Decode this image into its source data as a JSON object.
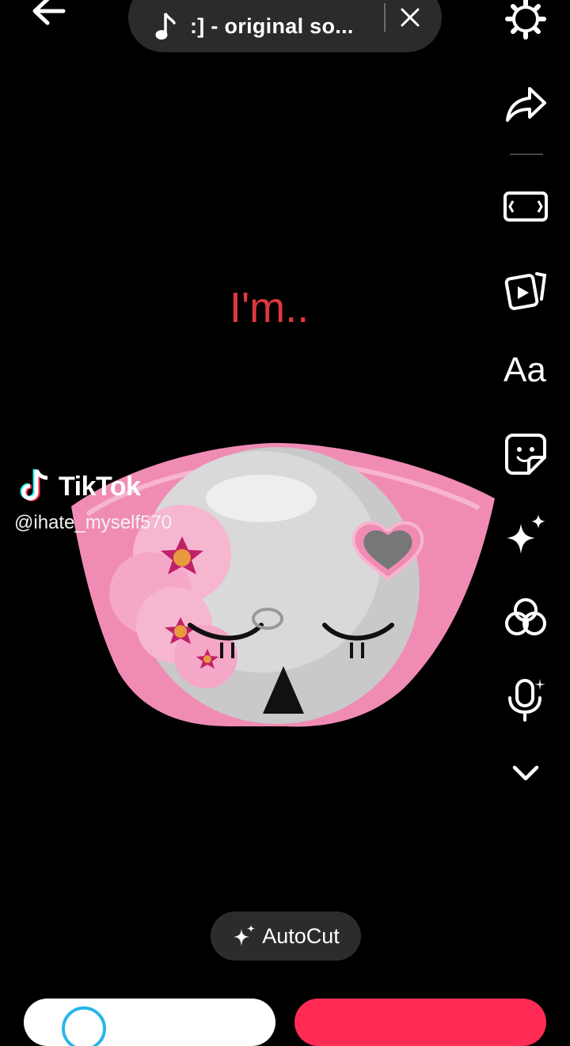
{
  "top_bar": {
    "back_icon": "arrow-left-icon",
    "sound_title": ":] - original so...",
    "note_icon": "music-note-icon",
    "close_icon": "close-icon"
  },
  "right_rail": {
    "icons": [
      "settings-gear-icon",
      "share-arrow-icon",
      "aspect-ratio-icon",
      "templates-icon",
      "text-icon",
      "sticker-icon",
      "effects-sparkle-icon",
      "filters-icon",
      "voice-effects-icon",
      "more-chevron-icon"
    ],
    "text_label": "Aa"
  },
  "video": {
    "caption": "I'm..",
    "watermark_brand": "TikTok",
    "watermark_user": "@ihate_myself570"
  },
  "bottom": {
    "autocut_label": "AutoCut"
  },
  "colors": {
    "caption": "#e0373f",
    "post_button": "#ff2b55",
    "pill": "#2b2b2b",
    "pink": "#f08cb4"
  }
}
